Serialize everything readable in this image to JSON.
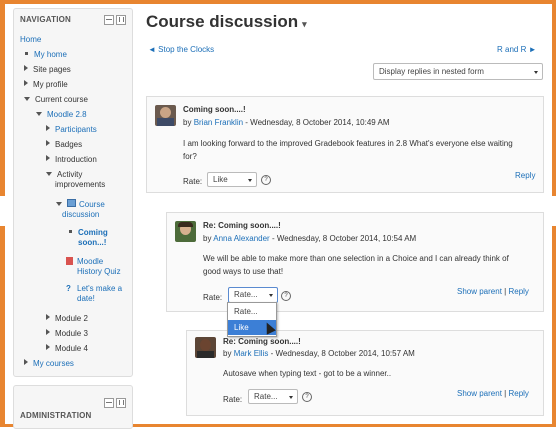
{
  "navigation": {
    "header": "NAVIGATION",
    "items": [
      {
        "label": "Home"
      },
      {
        "label": "My home"
      },
      {
        "label": "Site pages"
      },
      {
        "label": "My profile"
      },
      {
        "label": "Current course"
      },
      {
        "label": "Moodle 2.8"
      },
      {
        "label": "Participants"
      },
      {
        "label": "Badges"
      },
      {
        "label": "Introduction"
      },
      {
        "label": "Activity improvements",
        "line1": "Activity",
        "line2": "improvements"
      },
      {
        "label": "Course discussion",
        "line1": "Course",
        "line2": "discussion"
      },
      {
        "label": "Coming soon...!",
        "line1": "Coming",
        "line2": "soon...!"
      },
      {
        "label": "Moodle History Quiz",
        "line1": "Moodle",
        "line2": "History Quiz"
      },
      {
        "label": "Let's make a date!",
        "line1": "Let's make a",
        "line2": "date!"
      },
      {
        "label": "Module 2"
      },
      {
        "label": "Module 3"
      },
      {
        "label": "Module 4"
      },
      {
        "label": "My courses"
      }
    ]
  },
  "administration": {
    "header": "ADMINISTRATION"
  },
  "page": {
    "title": "Course discussion",
    "title_menu": "▾",
    "prev_link": "◄ Stop the Clocks",
    "next_link": "R and R ►",
    "display_mode": "Display replies in nested form"
  },
  "posts": [
    {
      "subject": "Coming soon....!",
      "by_prefix": "by",
      "author": "Brian Franklin",
      "date": " - Wednesday, 8 October 2014, 10:49 AM",
      "text": "I am looking forward to the improved Gradebook features in 2.8 What's everyone else waiting for?",
      "rate_label": "Rate:",
      "rate_value": "Like",
      "reply": "Reply"
    },
    {
      "subject": "Re: Coming soon....!",
      "by_prefix": "by",
      "author": "Anna Alexander",
      "date": " - Wednesday, 8 October 2014, 10:54 AM",
      "text": "We will be able to make more than one selection in a Choice and I can already think of good ways to use that!",
      "rate_label": "Rate:",
      "rate_value": "Rate...",
      "show_parent": "Show parent",
      "separator": "|",
      "reply": "Reply"
    },
    {
      "subject": "Re: Coming soon....!",
      "by_prefix": "by",
      "author": "Mark Ellis",
      "date": " - Wednesday, 8 October 2014, 10:57 AM",
      "text": "Autosave when typing text - got to be a winner..",
      "rate_label": "Rate:",
      "rate_value": "Rate...",
      "show_parent": "Show parent",
      "separator": "|",
      "reply": "Reply"
    }
  ],
  "rate_dropdown": {
    "options": [
      "Rate...",
      "Like"
    ],
    "highlighted": "Like"
  },
  "colors": {
    "accent_frame": "#e88530",
    "link": "#1c6fb8",
    "highlight": "#3c7fd6"
  }
}
